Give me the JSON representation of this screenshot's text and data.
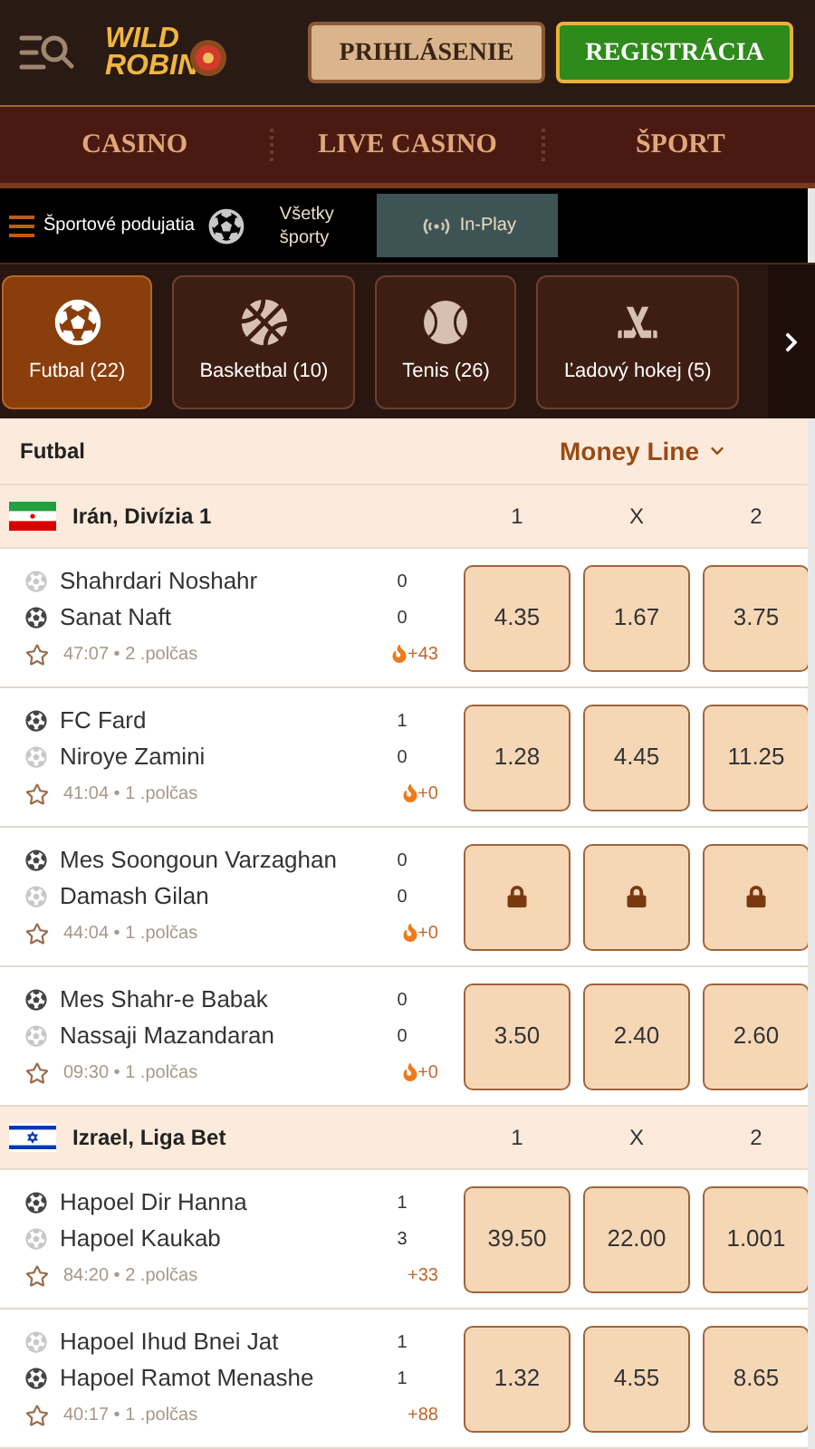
{
  "header": {
    "logo": [
      "WILD",
      "ROBIN"
    ],
    "login": "PRIHLÁSENIE",
    "register": "REGISTRÁCIA"
  },
  "nav": [
    {
      "label": "CASINO"
    },
    {
      "label": "LIVE CASINO"
    },
    {
      "label": "ŠPORT"
    }
  ],
  "subtabs": [
    {
      "label": "Športové podujatia",
      "selected": false
    },
    {
      "label": "Všetky športy",
      "selected": false
    },
    {
      "label": "In-Play",
      "selected": true
    }
  ],
  "sports": [
    {
      "label": "Futbal (22)",
      "selected": true
    },
    {
      "label": "Basketbal (10)",
      "selected": false
    },
    {
      "label": "Tenis (26)",
      "selected": false
    },
    {
      "label": "Ľadový hokej (5)",
      "selected": false
    }
  ],
  "market": {
    "sport": "Futbal",
    "type": "Money Line"
  },
  "leagues": [
    {
      "name": "Irán, Divízia 1",
      "kind": "iran",
      "columns": [
        "1",
        "X",
        "2"
      ],
      "matches": [
        {
          "teams": [
            {
              "name": "Shahrdari Noshahr",
              "highlighted": false,
              "score": "0"
            },
            {
              "name": "Sanat Naft",
              "highlighted": true,
              "score": "0"
            }
          ],
          "meta": "47:07 • 2 .polčas",
          "hot": true,
          "markets": "+43",
          "odds": [
            {
              "kind": "price",
              "value": "4.35"
            },
            {
              "kind": "price",
              "value": "1.67"
            },
            {
              "kind": "price",
              "value": "3.75"
            }
          ]
        },
        {
          "teams": [
            {
              "name": "FC Fard",
              "highlighted": true,
              "score": "1"
            },
            {
              "name": "Niroye Zamini",
              "highlighted": false,
              "score": "0"
            }
          ],
          "meta": "41:04 • 1 .polčas",
          "hot": true,
          "markets": "+0",
          "odds": [
            {
              "kind": "price",
              "value": "1.28"
            },
            {
              "kind": "price",
              "value": "4.45"
            },
            {
              "kind": "price",
              "value": "11.25"
            }
          ]
        },
        {
          "teams": [
            {
              "name": "Mes Soongoun Varzaghan",
              "highlighted": true,
              "score": "0"
            },
            {
              "name": "Damash Gilan",
              "highlighted": false,
              "score": "0"
            }
          ],
          "meta": "44:04 • 1 .polčas",
          "hot": true,
          "markets": "+0",
          "odds": [
            {
              "kind": "locked"
            },
            {
              "kind": "locked"
            },
            {
              "kind": "locked"
            }
          ]
        },
        {
          "teams": [
            {
              "name": "Mes Shahr-e Babak",
              "highlighted": true,
              "score": "0"
            },
            {
              "name": "Nassaji Mazandaran",
              "highlighted": false,
              "score": "0"
            }
          ],
          "meta": "09:30 • 1 .polčas",
          "hot": true,
          "markets": "+0",
          "odds": [
            {
              "kind": "price",
              "value": "3.50"
            },
            {
              "kind": "price",
              "value": "2.40"
            },
            {
              "kind": "price",
              "value": "2.60"
            }
          ]
        }
      ]
    },
    {
      "name": "Izrael, Liga Bet",
      "kind": "israel",
      "columns": [
        "1",
        "X",
        "2"
      ],
      "matches": [
        {
          "teams": [
            {
              "name": "Hapoel Dir Hanna",
              "highlighted": true,
              "score": "1"
            },
            {
              "name": "Hapoel Kaukab",
              "highlighted": false,
              "score": "3"
            }
          ],
          "meta": "84:20 • 2 .polčas",
          "hot": false,
          "markets": "+33",
          "odds": [
            {
              "kind": "price",
              "value": "39.50"
            },
            {
              "kind": "price",
              "value": "22.00"
            },
            {
              "kind": "price",
              "value": "1.001"
            }
          ]
        },
        {
          "teams": [
            {
              "name": "Hapoel Ihud Bnei Jat",
              "highlighted": false,
              "score": "1"
            },
            {
              "name": "Hapoel Ramot Menashe",
              "highlighted": true,
              "score": "1"
            }
          ],
          "meta": "40:17 • 1 .polčas",
          "hot": false,
          "markets": "+88",
          "odds": [
            {
              "kind": "price",
              "value": "1.32"
            },
            {
              "kind": "price",
              "value": "4.55"
            },
            {
              "kind": "price",
              "value": "8.65"
            }
          ]
        }
      ]
    }
  ]
}
